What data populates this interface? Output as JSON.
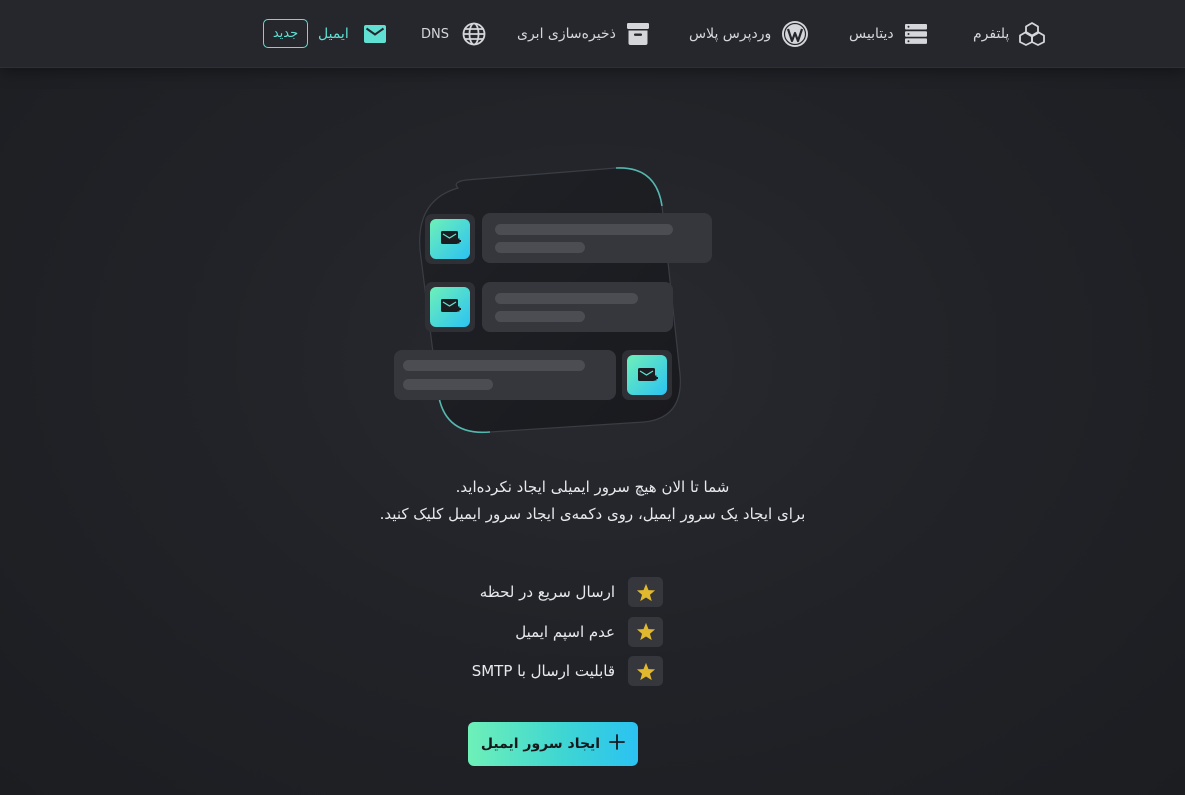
{
  "nav": {
    "items": [
      {
        "label": "پلتفرم",
        "icon": "cubes-icon"
      },
      {
        "label": "دیتابیس",
        "icon": "database-icon"
      },
      {
        "label": "وردپرس پلاس",
        "icon": "wordpress-icon"
      },
      {
        "label": "ذخیره‌سازی ابری",
        "icon": "archive-box-icon"
      },
      {
        "label": "DNS",
        "icon": "globe-icon"
      },
      {
        "label": "ایمیل",
        "icon": "envelope-icon",
        "active": true
      }
    ],
    "new_badge": "جدید"
  },
  "empty_state": {
    "line1": "شما تا الان هیچ سرور ایمیلی ایجاد نکرده‌اید.",
    "line2": "برای ایجاد یک سرور ایمیل، روی دکمه‌ی ایجاد سرور ایمیل کلیک کنید."
  },
  "features": [
    {
      "text": "ارسال سریع در لحظه",
      "icon": "star-icon"
    },
    {
      "text": "عدم اسپم ایمیل",
      "icon": "star-icon"
    },
    {
      "text": "قابلیت ارسال با SMTP",
      "icon": "star-icon"
    }
  ],
  "cta": {
    "label": "ایجاد سرور ایمیل",
    "icon": "plus-icon"
  },
  "colors": {
    "accent": "#5fe0d3",
    "background": "#212328",
    "nav_background": "#25272d",
    "star": "#e2b92e",
    "cta_gradient_start": "#6ef0b8",
    "cta_gradient_end": "#2bc2f2"
  }
}
